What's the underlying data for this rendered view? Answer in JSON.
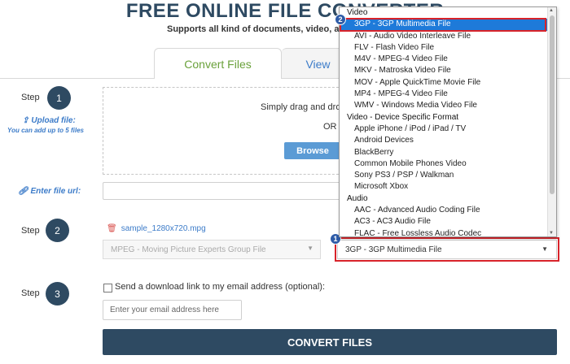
{
  "header": {
    "title": "FREE ONLINE FILE CONVERTER",
    "subtitle": "Supports all kind of documents, video, audio"
  },
  "tabs": [
    {
      "label": "Convert Files"
    },
    {
      "label": "View"
    }
  ],
  "steps": {
    "step_word": "Step",
    "numbers": [
      "1",
      "2",
      "3"
    ]
  },
  "upload": {
    "label": "Upload file:",
    "hint": "You can add up to 5 files",
    "drop_text": "Simply drag and drop",
    "or_text": "OR",
    "browse_label": "Browse"
  },
  "file_url": {
    "label": "Enter file url:"
  },
  "file": {
    "name": "sample_1280x720.mpg",
    "source_format": "MPEG - Moving Picture Experts Group File",
    "target_format": "3GP - 3GP Multimedia File"
  },
  "email": {
    "checkbox_label": "Send a download link to my email address (optional):",
    "placeholder": "Enter your email address here"
  },
  "convert_button": "CONVERT FILES",
  "dropdown": {
    "rows": [
      {
        "text": "Video",
        "kind": "group"
      },
      {
        "text": "3GP - 3GP Multimedia File",
        "kind": "item",
        "selected": true
      },
      {
        "text": "AVI - Audio Video Interleave File",
        "kind": "item"
      },
      {
        "text": "FLV - Flash Video File",
        "kind": "item"
      },
      {
        "text": "M4V - MPEG-4 Video File",
        "kind": "item"
      },
      {
        "text": "MKV - Matroska Video File",
        "kind": "item"
      },
      {
        "text": "MOV - Apple QuickTime Movie File",
        "kind": "item"
      },
      {
        "text": "MP4 - MPEG-4 Video File",
        "kind": "item"
      },
      {
        "text": "WMV - Windows Media Video File",
        "kind": "item"
      },
      {
        "text": "Video - Device Specific Format",
        "kind": "group"
      },
      {
        "text": "Apple iPhone / iPod / iPad / TV",
        "kind": "item"
      },
      {
        "text": "Android Devices",
        "kind": "item"
      },
      {
        "text": "BlackBerry",
        "kind": "item"
      },
      {
        "text": "Common Mobile Phones Video",
        "kind": "item"
      },
      {
        "text": "Sony PS3 / PSP / Walkman",
        "kind": "item"
      },
      {
        "text": "Microsoft Xbox",
        "kind": "item"
      },
      {
        "text": "Audio",
        "kind": "group"
      },
      {
        "text": "AAC - Advanced Audio Coding File",
        "kind": "item"
      },
      {
        "text": "AC3 - AC3 Audio File",
        "kind": "item"
      },
      {
        "text": "FLAC - Free Lossless Audio Codec",
        "kind": "item"
      }
    ]
  },
  "annotations": [
    {
      "number": "1"
    },
    {
      "number": "2"
    }
  ],
  "colors": {
    "navy": "#2e4a62",
    "link_blue": "#3d7cc9",
    "active_tab_green": "#6aa13b",
    "highlight_blue": "#1e7ad9",
    "annotation_red": "#d8232a"
  }
}
